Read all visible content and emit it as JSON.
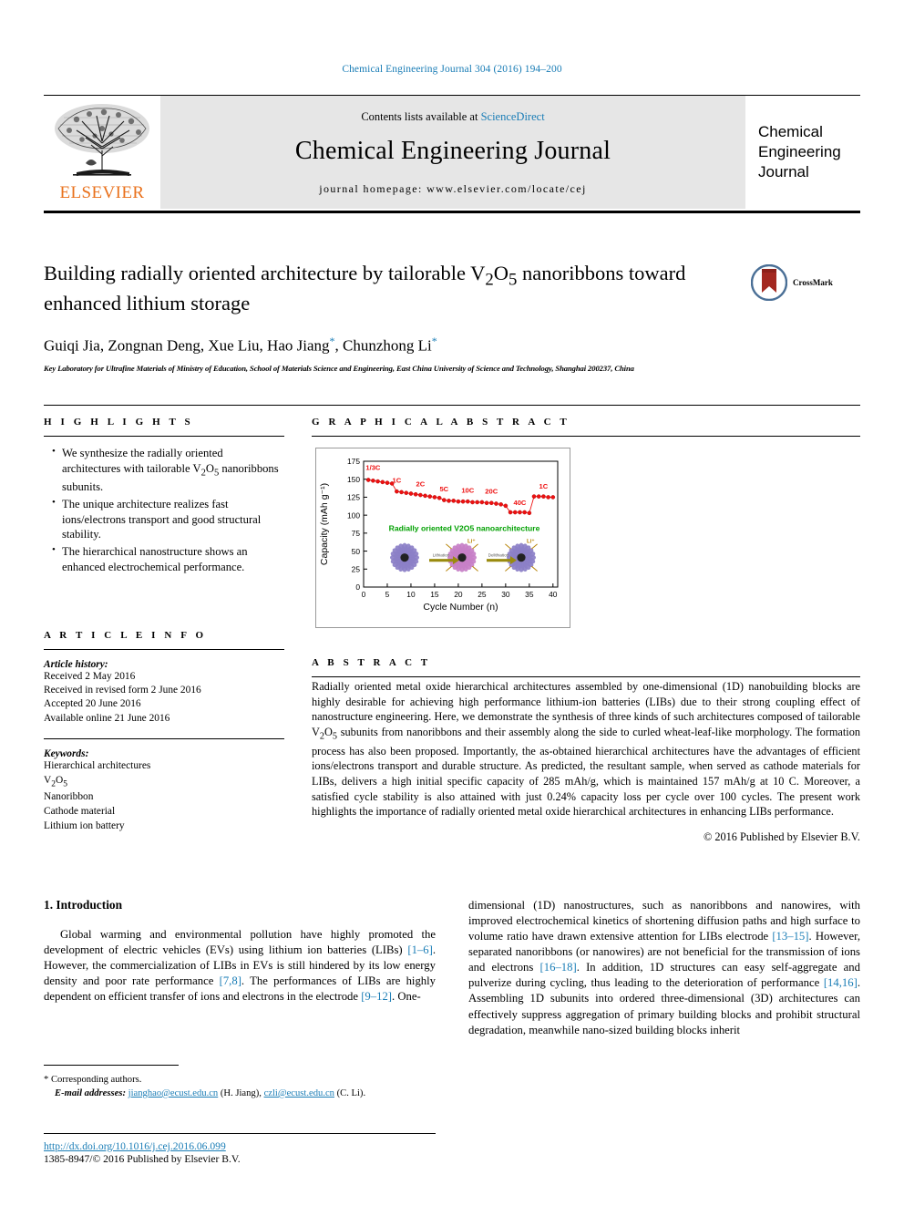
{
  "running_head": "Chemical Engineering Journal 304 (2016) 194–200",
  "masthead": {
    "contents_prefix": "Contents lists available at ",
    "sciencedirect": "ScienceDirect",
    "journal_title": "Chemical Engineering Journal",
    "homepage": "journal homepage: www.elsevier.com/locate/cej",
    "publisher": "ELSEVIER",
    "cover_line1": "Chemical",
    "cover_line2": "Engineering",
    "cover_line3": "Journal"
  },
  "article": {
    "title": "Building radially oriented architecture by tailorable V2O5 nanoribbons toward enhanced lithium storage",
    "title_part1": "Building radially oriented architecture by tailorable V",
    "title_sub1": "2",
    "title_mid": "O",
    "title_sub2": "5",
    "title_part2": " nanoribbons toward enhanced lithium storage",
    "crossmark_label": "CrossMark",
    "authors": "Guiqi Jia, Zongnan Deng, Xue Liu, Hao Jiang, Chunzhong Li",
    "author_list": [
      {
        "name": "Guiqi Jia",
        "star": false
      },
      {
        "name": "Zongnan Deng",
        "star": false
      },
      {
        "name": "Xue Liu",
        "star": false
      },
      {
        "name": "Hao Jiang",
        "star": true
      },
      {
        "name": "Chunzhong Li",
        "star": true
      }
    ],
    "affiliation": "Key Laboratory for Ultrafine Materials of Ministry of Education, School of Materials Science and Engineering, East China University of Science and Technology, Shanghai 200237, China"
  },
  "highlights": {
    "heading": "H I G H L I G H T S",
    "items": [
      "We synthesize the radially oriented architectures with tailorable V2O5 nanoribbons subunits.",
      "The unique architecture realizes fast ions/electrons transport and good structural stability.",
      "The hierarchical nanostructure shows an enhanced electrochemical performance."
    ]
  },
  "graphical_abstract": {
    "heading": "G R A P H I C A L   A B S T R A C T"
  },
  "article_info": {
    "heading": "A R T I C L E   I N F O",
    "history_label": "Article history:",
    "history": [
      "Received 2 May 2016",
      "Received in revised form 2 June 2016",
      "Accepted 20 June 2016",
      "Available online 21 June 2016"
    ],
    "keywords_label": "Keywords:",
    "keywords": [
      "Hierarchical architectures",
      "V2O5",
      "Nanoribbon",
      "Cathode material",
      "Lithium ion battery"
    ]
  },
  "abstract": {
    "heading": "A B S T R A C T",
    "text": "Radially oriented metal oxide hierarchical architectures assembled by one-dimensional (1D) nanobuilding blocks are highly desirable for achieving high performance lithium-ion batteries (LIBs) due to their strong coupling effect of nanostructure engineering. Here, we demonstrate the synthesis of three kinds of such architectures composed of tailorable V2O5 subunits from nanoribbons and their assembly along the side to curled wheat-leaf-like morphology. The formation process has also been proposed. Importantly, the as-obtained hierarchical architectures have the advantages of efficient ions/electrons transport and durable structure. As predicted, the resultant sample, when served as cathode materials for LIBs, delivers a high initial specific capacity of 285 mAh/g, which is maintained 157 mAh/g at 10 C. Moreover, a satisfied cycle stability is also attained with just 0.24% capacity loss per cycle over 100 cycles. The present work highlights the importance of radially oriented metal oxide hierarchical architectures in enhancing LIBs performance.",
    "copyright": "© 2016 Published by Elsevier B.V."
  },
  "body": {
    "section_heading": "1. Introduction",
    "left_paragraph": "Global warming and environmental pollution have highly promoted the development of electric vehicles (EVs) using lithium ion batteries (LIBs) [1–6]. However, the commercialization of LIBs in EVs is still hindered by its low energy density and poor rate performance [7,8]. The performances of LIBs are highly dependent on efficient transfer of ions and electrons in the electrode [9–12]. One-",
    "right_paragraph": "dimensional (1D) nanostructures, such as nanoribbons and nanowires, with improved electrochemical kinetics of shortening diffusion paths and high surface to volume ratio have drawn extensive attention for LIBs electrode [13–15]. However, separated nanoribbons (or nanowires) are not beneficial for the transmission of ions and electrons [16–18]. In addition, 1D structures can easy self-aggregate and pulverize during cycling, thus leading to the deterioration of performance [14,16]. Assembling 1D subunits into ordered three-dimensional (3D) architectures can effectively suppress aggregation of primary building blocks and prohibit structural degradation, meanwhile nano-sized building blocks inherit"
  },
  "footnote": {
    "corresponding": "* Corresponding authors.",
    "email_label": "E-mail addresses:",
    "email1": "jianghao@ecust.edu.cn",
    "email1_owner": "(H. Jiang),",
    "email2": "czli@ecust.edu.cn",
    "email2_owner": "(C. Li).",
    "doi": "http://dx.doi.org/10.1016/j.cej.2016.06.099",
    "issn": "1385-8947/© 2016 Published by Elsevier B.V."
  },
  "chart_data": {
    "type": "line",
    "title": "",
    "xlabel": "Cycle Number (n)",
    "ylabel": "Capacity (mAh g⁻¹)",
    "xlim": [
      0,
      41
    ],
    "ylim": [
      0,
      175
    ],
    "xticks": [
      0,
      5,
      10,
      15,
      20,
      25,
      30,
      35,
      40
    ],
    "yticks": [
      0,
      25,
      50,
      75,
      100,
      125,
      150,
      175
    ],
    "grid": false,
    "series_color": "#ee1111",
    "marker": "circle",
    "inset_caption": "Radially oriented V2O5 nanoarchitecture",
    "inset_caption_color": "#00a000",
    "inset_arrow_labels": [
      "Lithiation",
      "Delithiation"
    ],
    "inset_ion_label": "Li⁺",
    "rate_labels": [
      {
        "text": "1/3C",
        "cycle": 2,
        "capacity": 163
      },
      {
        "text": "1C",
        "cycle": 7,
        "capacity": 145
      },
      {
        "text": "2C",
        "cycle": 12,
        "capacity": 140
      },
      {
        "text": "5C",
        "cycle": 17,
        "capacity": 133
      },
      {
        "text": "10C",
        "cycle": 22,
        "capacity": 131
      },
      {
        "text": "20C",
        "cycle": 27,
        "capacity": 130
      },
      {
        "text": "40C",
        "cycle": 33,
        "capacity": 114
      },
      {
        "text": "1C",
        "cycle": 38,
        "capacity": 137
      }
    ],
    "x": [
      1,
      2,
      3,
      4,
      5,
      6,
      7,
      8,
      9,
      10,
      11,
      12,
      13,
      14,
      15,
      16,
      17,
      18,
      19,
      20,
      21,
      22,
      23,
      24,
      25,
      26,
      27,
      28,
      29,
      30,
      31,
      32,
      33,
      34,
      35,
      36,
      37,
      38,
      39,
      40
    ],
    "values": [
      149,
      148,
      147,
      146,
      145,
      144,
      133,
      132,
      131,
      130,
      129,
      128,
      127,
      126,
      125,
      124,
      121,
      120,
      120,
      119,
      119,
      119,
      118,
      118,
      118,
      117,
      117,
      116,
      115,
      113,
      104,
      104,
      104,
      104,
      103,
      126,
      126,
      126,
      125,
      125
    ]
  }
}
